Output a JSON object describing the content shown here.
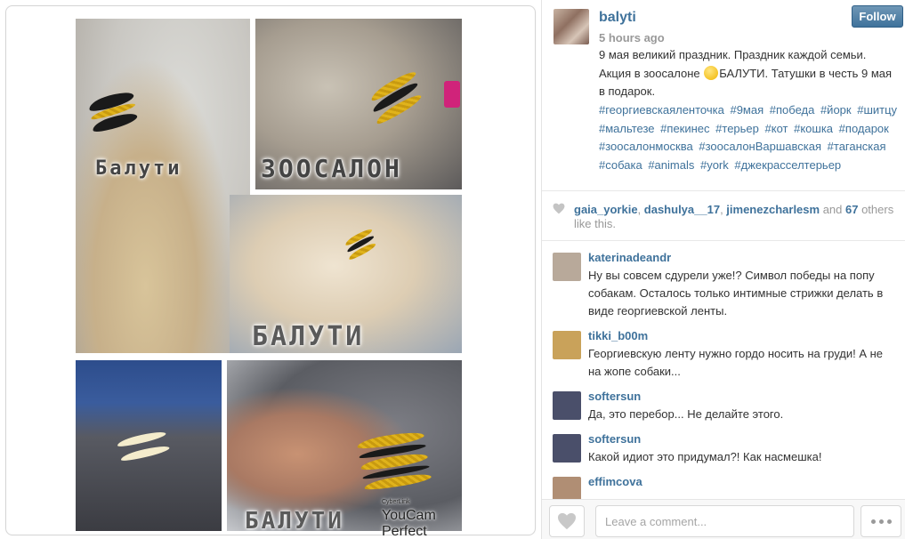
{
  "post": {
    "username": "balyti",
    "timestamp": "5 hours ago",
    "follow_label": "Follow",
    "caption_part1": "9 мая великий праздник. Праздник каждой семьи. Акция в зоосалоне ",
    "caption_emoji": "smiling-face-icon",
    "caption_part2": "БАЛУТИ. Татушки в честь 9 мая в подарок.",
    "hashtags": [
      "#георгиевскаяленточка",
      "#9мая",
      "#победа",
      "#йорк",
      "#шитцу",
      "#мальтезе",
      "#пекинес",
      "#терьер",
      "#кот",
      "#кошка",
      "#подарок",
      "#зоосалонмосква",
      "#зоосалонВаршавская",
      "#таганская",
      "#собака",
      "#animals",
      "#york",
      "#джекрасселтерьер"
    ]
  },
  "photo": {
    "labels": [
      "Балути",
      "ЗООСАЛОН",
      "БАЛУТИ",
      "БАЛУТИ"
    ],
    "watermark_small": "CyberLink",
    "watermark": "YouCam Perfect"
  },
  "likes": {
    "users": [
      "gaia_yorkie",
      "dashulya__17",
      "jimenezcharlesm"
    ],
    "sep": ", ",
    "and_text": " and ",
    "count": "67",
    "suffix": " others like this."
  },
  "comments": [
    {
      "user": "katerinadeandr",
      "text": "Ну вы совсем сдурели уже!? Символ победы на попу собакам. Осталось только интимные стрижки делать в виде георгиевской ленты.",
      "avatar_color": "#b8a99a"
    },
    {
      "user": "tikki_b00m",
      "text": "Георгиевскую ленту нужно гордо носить на груди! А не на жопе собаки...",
      "avatar_color": "#c9a25a"
    },
    {
      "user": "softersun",
      "text": "Да, это перебор... Не делайте этого.",
      "avatar_color": "#4a4f6a"
    },
    {
      "user": "softersun",
      "text": "Какой идиот это придумал?! Как насмешка!",
      "avatar_color": "#4a4f6a"
    },
    {
      "user": "effimcova",
      "text": "",
      "avatar_color": "#b08e74"
    }
  ],
  "footer": {
    "comment_placeholder": "Leave a comment...",
    "like_icon": "heart-icon",
    "more_icon": "more-options-icon"
  },
  "colors": {
    "link": "#3f729b",
    "muted": "#999999",
    "follow_bg": "#3f729b"
  }
}
